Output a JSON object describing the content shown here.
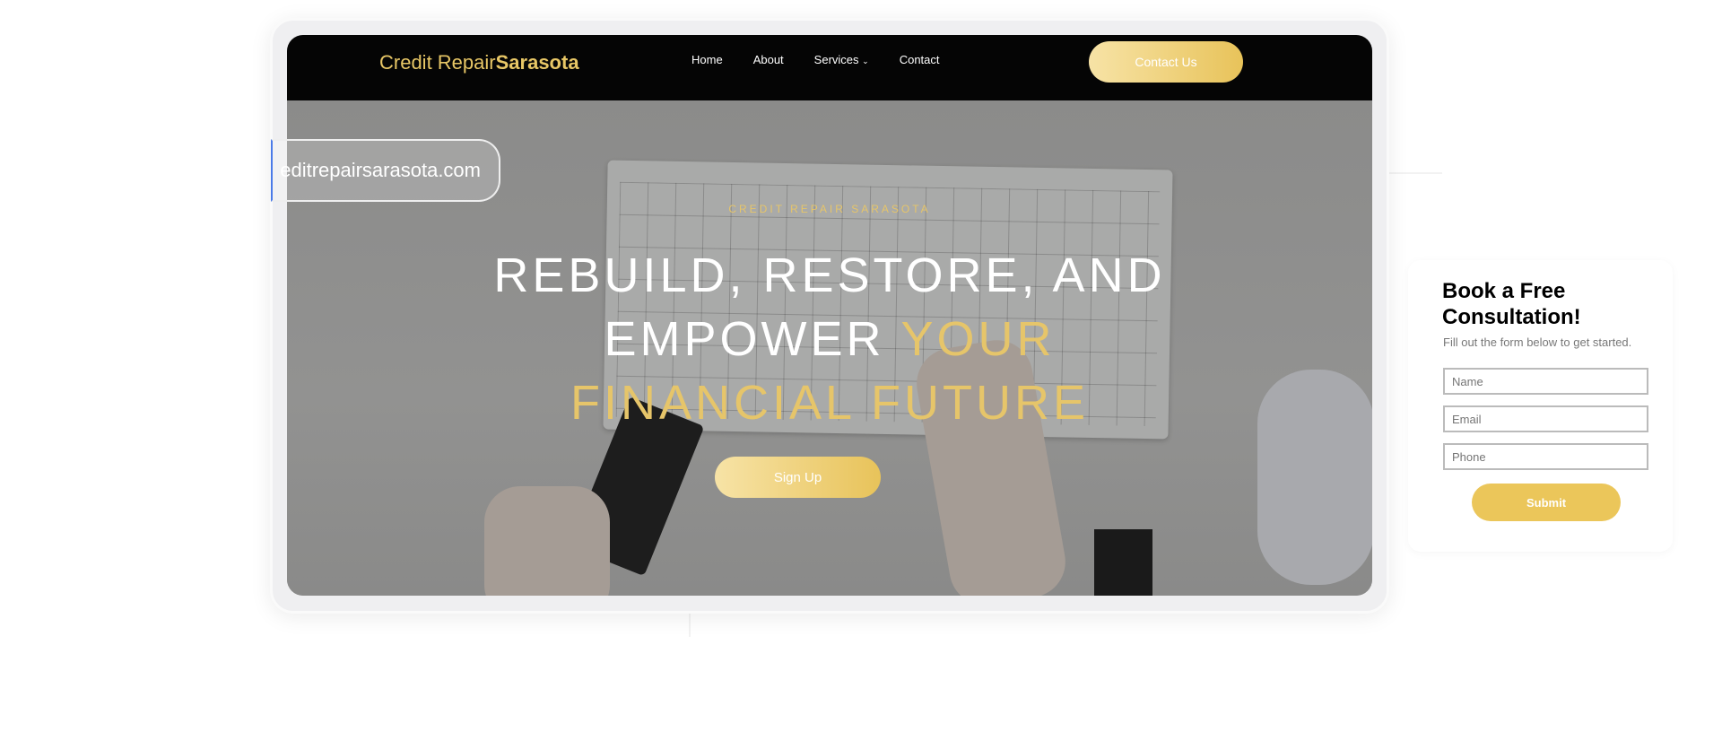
{
  "nav": {
    "logo_light": "Credit Repair",
    "logo_bold": "Sarasota",
    "links": [
      "Home",
      "About",
      "Services",
      "Contact"
    ],
    "services_chevron": "chevron-down-icon",
    "contact_button": "Contact Us"
  },
  "url_pill": {
    "text": "editrepairsarasota.com"
  },
  "hero": {
    "kicker": "CREDIT REPAIR SARASOTA",
    "line1": "REBUILD, RESTORE, AND",
    "line2_white": "EMPOWER ",
    "line2_gold": "YOUR",
    "line3": "FINANCIAL FUTURE",
    "signup_button": "Sign Up"
  },
  "form": {
    "title": "Book a Free Consultation!",
    "subtitle": "Fill out the form below to get started.",
    "name_placeholder": "Name",
    "email_placeholder": "Email",
    "phone_placeholder": "Phone",
    "submit": "Submit"
  },
  "colors": {
    "gold": "#e6c56a",
    "nav_bg": "#050505",
    "submit": "#ebc65a"
  }
}
